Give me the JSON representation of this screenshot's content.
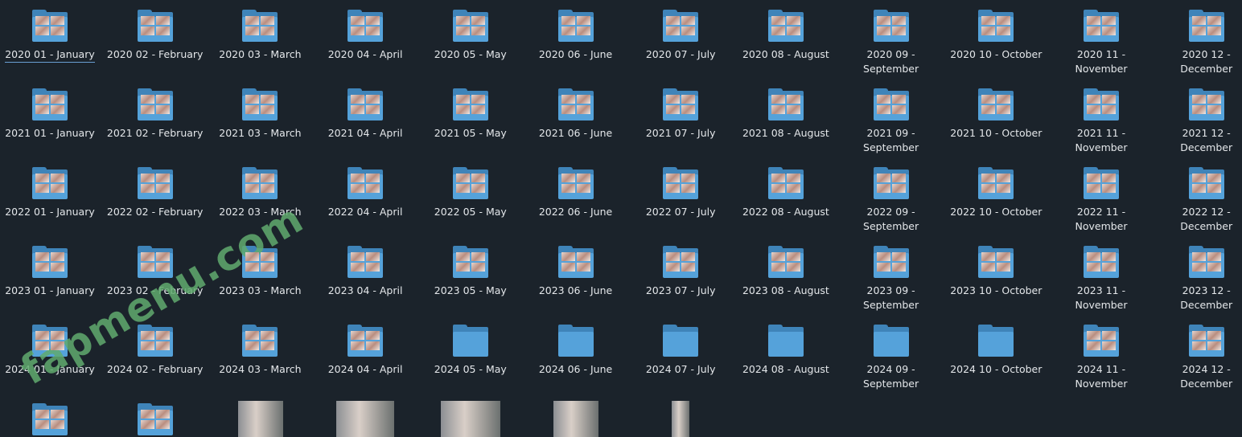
{
  "folders": [
    "2020 01 - January",
    "2020 02 - February",
    "2020 03 - March",
    "2020 04 - April",
    "2020 05 - May",
    "2020 06 - June",
    "2020 07 - July",
    "2020 08 - August",
    "2020 09 - September",
    "2020 10 - October",
    "2020 11 - November",
    "2020 12 - December",
    "2021 01 - January",
    "2021 02 - February",
    "2021 03 - March",
    "2021 04 - April",
    "2021 05 - May",
    "2021 06 - June",
    "2021 07 - July",
    "2021 08 - August",
    "2021 09 - September",
    "2021 10 - October",
    "2021 11 - November",
    "2021 12 - December",
    "2022 01 - January",
    "2022 02 - February",
    "2022 03 - March",
    "2022 04 - April",
    "2022 05 - May",
    "2022 06 - June",
    "2022 07 - July",
    "2022 08 - August",
    "2022 09 - September",
    "2022 10 - October",
    "2022 11 - November",
    "2022 12 - December",
    "2023 01 - January",
    "2023 02 - February",
    "2023 03 - March",
    "2023 04 - April",
    "2023 05 - May",
    "2023 06 - June",
    "2023 07 - July",
    "2023 08 - August",
    "2023 09 - September",
    "2023 10 - October",
    "2023 11 - November",
    "2023 12 - December",
    "2024 01 - January",
    "2024 02 - February",
    "2024 03 - March",
    "2024 04 - April",
    "2024 05 - May",
    "2024 06 - June",
    "2024 07 - July",
    "2024 08 - August",
    "2024 09 - September",
    "2024 10 - October",
    "2024 11 - November",
    "2024 12 - December"
  ],
  "empty_folders": [
    "2024 05 - May",
    "2024 06 - June",
    "2024 07 - July",
    "2024 08 - August",
    "2024 09 - September",
    "2024 10 - October"
  ],
  "focused_folder": "2020 01 - January",
  "bottom_row": {
    "folders_with_preview": 2,
    "image_files": 5
  },
  "watermark": "fapmenu.com",
  "colors": {
    "background": "#1b232b",
    "folder_front": "#55a2da",
    "folder_back": "#3f84b9",
    "label_text": "#e4e7ea",
    "focus_underline": "#6aa0d3",
    "watermark": "#60aa6e"
  }
}
